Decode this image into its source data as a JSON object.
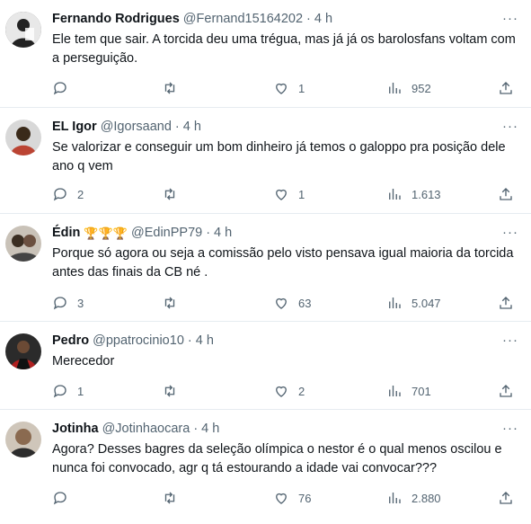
{
  "tweets": [
    {
      "name": "Fernando Rodrigues",
      "handle": "@Fernand15164202",
      "time": "4 h",
      "text": "Ele tem que sair. A torcida deu uma trégua, mas já já os barolosfans voltam com a perseguição.",
      "replies": "",
      "retweets": "",
      "likes": "1",
      "views": "952",
      "avatar_color": "#555555"
    },
    {
      "name": "EL Igor",
      "handle": "@Igorsaand",
      "time": "4 h",
      "text": "Se valorizar e conseguir um bom dinheiro já temos o galoppo pra posição dele ano q vem",
      "replies": "2",
      "retweets": "",
      "likes": "1",
      "views": "1.613",
      "avatar_color": "#3a3a3a"
    },
    {
      "name": "Édin",
      "badges": "🏆🏆🏆",
      "handle": "@EdinPP79",
      "time": "4 h",
      "text": "Porque só agora ou seja a comissão pelo visto pensava igual maioria da torcida antes das finais da CB né .",
      "replies": "3",
      "retweets": "",
      "likes": "63",
      "views": "5.047",
      "avatar_color": "#7a6a5a"
    },
    {
      "name": "Pedro",
      "handle": "@ppatrocinio10",
      "time": "4 h",
      "text": "Merecedor",
      "replies": "1",
      "retweets": "",
      "likes": "2",
      "views": "701",
      "avatar_color": "#b02020"
    },
    {
      "name": "Jotinha",
      "handle": "@Jotinhaocara",
      "time": "4 h",
      "text": "Agora? Desses bagres da seleção olímpica o nestor é o qual menos oscilou e nunca foi convocado, agr q tá estourando a idade vai convocar???",
      "replies": "",
      "retweets": "",
      "likes": "76",
      "views": "2.880",
      "avatar_color": "#8a6a50"
    }
  ],
  "separator": "·"
}
